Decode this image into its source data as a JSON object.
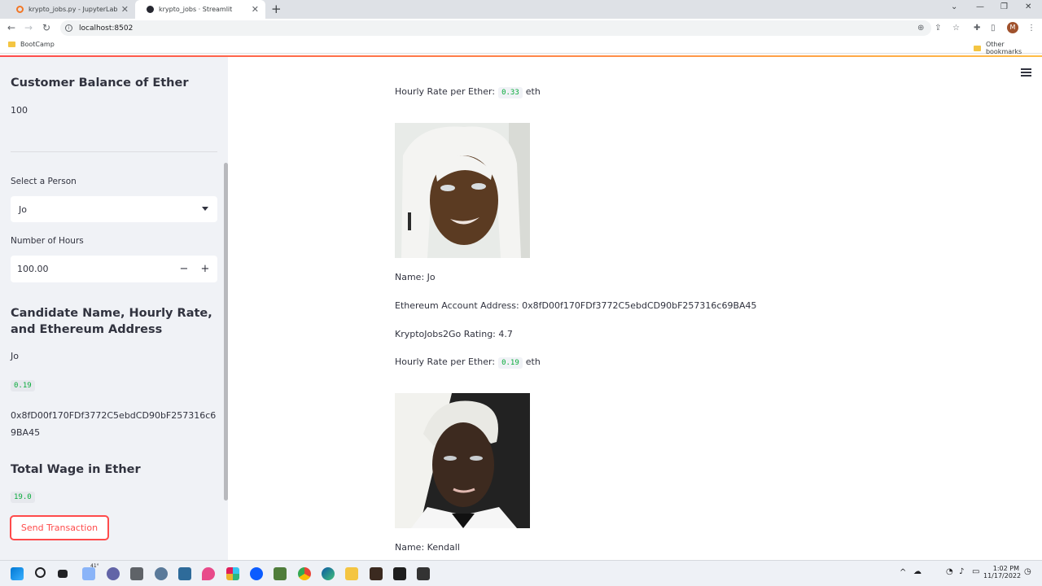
{
  "browser": {
    "tabs": [
      {
        "title": "krypto_jobs.py - JupyterLab",
        "active": false
      },
      {
        "title": "krypto_jobs · Streamlit",
        "active": true
      }
    ],
    "url": "localhost:8502",
    "bookmarks": {
      "left": "BootCamp",
      "right": "Other bookmarks"
    },
    "profile_initial": "M"
  },
  "sidebar": {
    "balance_heading": "Customer Balance of Ether",
    "balance_value": "100",
    "select_label": "Select a Person",
    "select_value": "Jo",
    "hours_label": "Number of Hours",
    "hours_value": "100.00",
    "minus": "−",
    "plus": "+",
    "candidate_heading": "Candidate Name, Hourly Rate, and Ethereum Address",
    "candidate_name": "Jo",
    "candidate_rate": "0.19",
    "candidate_address": "0x8fD00f170FDf3772C5ebdCD90bF257316c69BA45",
    "wage_heading": "Total Wage in Ether",
    "wage_value": "19.0",
    "send_button": "Send Transaction"
  },
  "main": {
    "top_rate": {
      "prefix": "Hourly Rate per Ether:",
      "value": "0.33",
      "unit": "eth"
    },
    "candidates": [
      {
        "name": "Name: Jo",
        "address": "Ethereum Account Address: 0x8fD00f170FDf3772C5ebdCD90bF257316c69BA45",
        "rating": "KryptoJobs2Go Rating: 4.7",
        "rate_prefix": "Hourly Rate per Ether:",
        "rate_value": "0.19",
        "rate_unit": "eth"
      },
      {
        "name": "Name: Kendall"
      }
    ]
  },
  "taskbar": {
    "weather": "41°",
    "time": "1:02 PM",
    "date": "11/17/2022"
  },
  "colors": {
    "accent": "#ff4b4b",
    "code_green": "#09ab3b",
    "sidebar_bg": "#f0f2f6"
  }
}
